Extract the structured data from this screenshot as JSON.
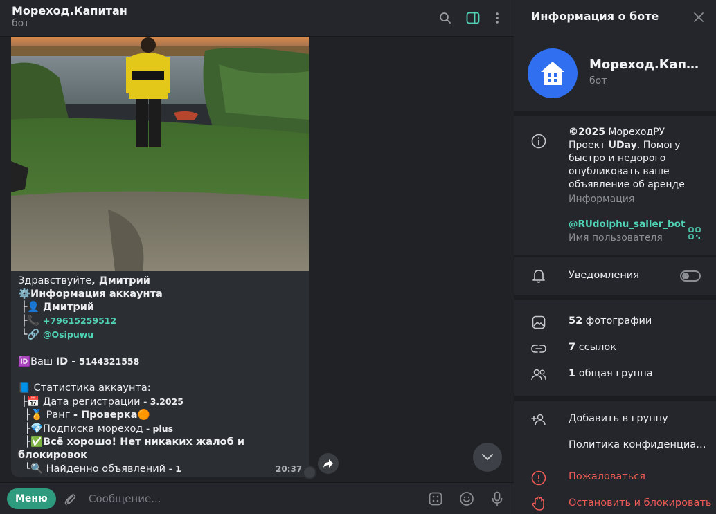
{
  "chat": {
    "title": "Мореход.Капитан",
    "subtitle": "бот"
  },
  "message": {
    "greeting_prefix": "Здравствуйте",
    "greeting_name": ", Дмитрий",
    "account_header": "⚙️Информация аккаунта",
    "name_line_prefix": " ├👤 ",
    "name": "Дмитрий",
    "phone_prefix": " ├📞 ",
    "phone": "+79615259512",
    "username_prefix": " └🔗 ",
    "username": "@Osipuwu",
    "id_prefix": "🆔Ваш ",
    "id_label": "ID - ",
    "id_value": "5144321558",
    "stats_header": "📘 Статистика аккаунта:",
    "reg_prefix": " ├📅 Дата регистрации ",
    "reg_value": "- 3.2025",
    "rank_prefix": "  ├🏅 Ранг ",
    "rank_value": "- Проверка",
    "rank_emoji": "🟠",
    "sub_prefix": "  ├💎Подписка мореход ",
    "sub_value": "- plus",
    "status_prefix": "  ├✅",
    "status_value": "Всё хорошо! Нет никаких жалоб и блокировок",
    "found_prefix": "  └🔍 Найденно объявлений ",
    "found_value": "- 1",
    "time": "20:37"
  },
  "composer": {
    "menu_label": "Меню",
    "placeholder": "Сообщение..."
  },
  "info": {
    "title": "Информация о боте",
    "bot_name": "Мореход.Капитан",
    "bot_sub": "бот",
    "about_copyright": "©2025",
    "about_line1": " МореходРУ",
    "about_project": "Проект ",
    "about_uday": "UDay",
    "about_rest": ". Помогу быстро и недорого опубликовать ваше объявление об аренде",
    "about_caption": "Информация",
    "username": "@RUdolphu_saller_bot",
    "username_caption": "Имя пользователя",
    "notifications": "Уведомления",
    "photos_count": "52",
    "photos_label": " фотографии",
    "links_count": "7",
    "links_label": " ссылок",
    "groups_count": "1",
    "groups_label": " общая группа",
    "add_to_group": "Добавить в группу",
    "privacy": "Политика конфиденциальности",
    "report": "Пожаловаться",
    "stop_block": "Остановить и блокировать"
  },
  "colors": {
    "accent": "#4fd3b4",
    "menu_button": "#2e9b7f",
    "avatar": "#2f6ff0",
    "danger": "#ef5a56"
  }
}
